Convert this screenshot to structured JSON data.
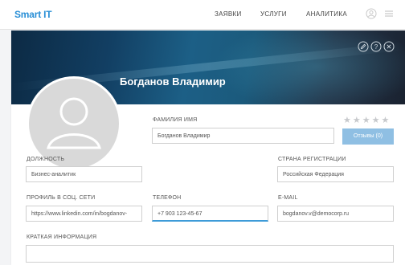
{
  "header": {
    "logo": "Smart IT",
    "nav": [
      "ЗАЯВКИ",
      "УСЛУГИ",
      "АНАЛИТИКА"
    ],
    "icons": [
      "user-icon",
      "menu-icon"
    ]
  },
  "profile": {
    "name": "Богданов Владимир",
    "banner_icons": [
      "edit-icon",
      "help-icon",
      "close-icon"
    ],
    "rating_stars": 5,
    "rating_value": 0,
    "reviews_button": "Отзывы (0)"
  },
  "fields": {
    "fullname": {
      "label": "ФАМИЛИЯ ИМЯ",
      "value": "Богданов Владимир"
    },
    "position": {
      "label": "ДОЛЖНОСТЬ",
      "value": "Бизнес-аналитик"
    },
    "country": {
      "label": "СТРАНА РЕГИСТРАЦИИ",
      "value": "Российская Федерация"
    },
    "social": {
      "label": "ПРОФИЛЬ В СОЦ. СЕТИ",
      "value": "https://www.linkedin.com/in/bogdanov-"
    },
    "phone": {
      "label": "ТЕЛЕФОН",
      "value": "+7 903 123-45-67"
    },
    "email": {
      "label": "E-MAIL",
      "value": "bogdanov.v@democorp.ru"
    },
    "about": {
      "label": "КРАТКАЯ ИНФОРМАЦИЯ",
      "value": ""
    }
  },
  "colors": {
    "accent": "#2a8fd6",
    "button": "#8fbfe3",
    "banner_dark": "#0c2a44"
  }
}
